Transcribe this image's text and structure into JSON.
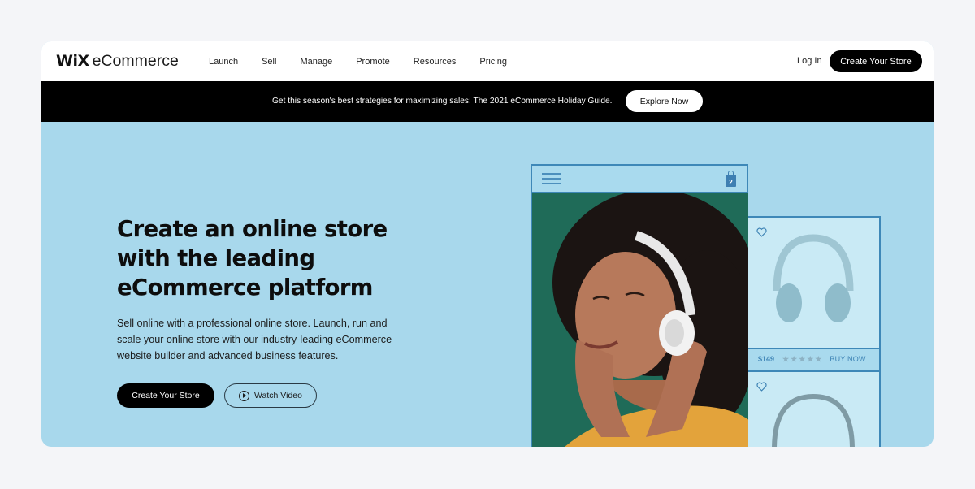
{
  "header": {
    "logo_wix": "WiX",
    "logo_product": "eCommerce",
    "nav": [
      "Launch",
      "Sell",
      "Manage",
      "Promote",
      "Resources",
      "Pricing"
    ],
    "login_label": "Log In",
    "cta_label": "Create Your Store"
  },
  "banner": {
    "text": "Get this season's best strategies for maximizing sales: The 2021 eCommerce Holiday Guide.",
    "button_label": "Explore Now"
  },
  "hero": {
    "title_lines": [
      "Create an online store",
      "with the leading",
      "eCommerce platform"
    ],
    "subtitle_lines": [
      "Sell online with a professional online store. Launch, run and",
      "scale your online store with our industry-leading eCommerce",
      "website builder and advanced business features."
    ],
    "primary_button": "Create Your Store",
    "secondary_button": "Watch Video"
  },
  "mockup": {
    "cart_count": "2",
    "product": {
      "price": "$149",
      "stars": "★★★★★",
      "rating": 0,
      "buy_label": "BUY NOW"
    }
  },
  "colors": {
    "hero_bg": "#a8d8ec",
    "accent_blue": "#3e88b8",
    "photo_bg": "#1f6b58",
    "button_dark": "#000000"
  }
}
